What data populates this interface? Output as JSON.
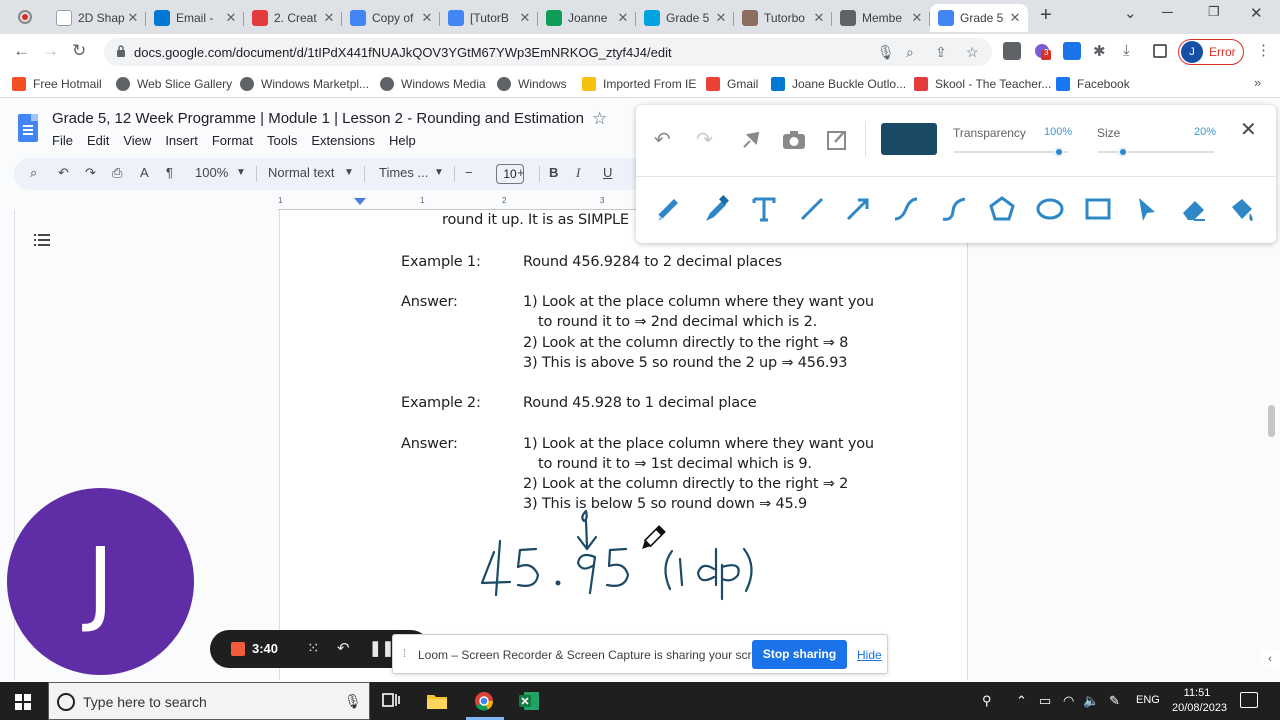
{
  "browser": {
    "tabs": [
      {
        "title": "2D Shap",
        "color": "#ffffff",
        "icon": "blank-page-icon"
      },
      {
        "title": "Email -",
        "color": "#0078d4",
        "icon": "outlook-icon"
      },
      {
        "title": "2. Creat",
        "color": "#e43c3c",
        "icon": "skool-icon"
      },
      {
        "title": "Copy of",
        "color": "#4285f4",
        "icon": "canva-icon"
      },
      {
        "title": "[TutorB",
        "color": "#4285f4",
        "icon": "docs-icon"
      },
      {
        "title": "Joanne",
        "color": "#0f9d58",
        "icon": "sheets-icon"
      },
      {
        "title": "Grade 5",
        "color": "#00a3e0",
        "icon": "vimeo-icon"
      },
      {
        "title": "Tutorbo",
        "color": "#8d6e63",
        "icon": "tutorbox-icon"
      },
      {
        "title": "Membe",
        "color": "#5f6368",
        "icon": "globe-icon"
      },
      {
        "title": "Grade 5",
        "color": "#4285f4",
        "icon": "docs-icon",
        "active": true
      }
    ],
    "url": "docs.google.com/document/d/1tIPdX441fNUAJkQOV3YGtM67YWp3EmNRKOG_ztyf4J4/edit",
    "profile_initial": "J",
    "profile_status": "Error",
    "extension_badge": "3",
    "bookmarks": [
      {
        "label": "Free Hotmail",
        "color": "#f25022"
      },
      {
        "label": "Web Slice Gallery",
        "color": "#5f6368"
      },
      {
        "label": "Windows Marketpl...",
        "color": "#5f6368"
      },
      {
        "label": "Windows Media",
        "color": "#5f6368"
      },
      {
        "label": "Windows",
        "color": "#5f6368"
      },
      {
        "label": "Imported From IE",
        "color": "#f4c20d"
      },
      {
        "label": "Gmail",
        "color": "#ea4335"
      },
      {
        "label": "Joane Buckle Outlo...",
        "color": "#0078d4"
      },
      {
        "label": "Skool - The Teacher...",
        "color": "#e43c3c"
      },
      {
        "label": "Facebook",
        "color": "#1877f2"
      }
    ]
  },
  "docs": {
    "title": "Grade 5, 12 Week Programme | Module 1 | Lesson 2 - Rounding and Estimation",
    "menus": [
      "File",
      "Edit",
      "View",
      "Insert",
      "Format",
      "Tools",
      "Extensions",
      "Help"
    ],
    "zoom": "100%",
    "style": "Normal text",
    "font": "Times ...",
    "font_size": "10",
    "ruler": [
      "1",
      "1",
      "2",
      "3"
    ],
    "lines": {
      "cutoff": "round it up. It is as SIMPLE",
      "ex1_label": "Example 1:",
      "ex1_text": "Round 456.9284 to 2 decimal places",
      "ans1_label": "Answer:",
      "ans1_l1": "1) Look at the place column where they want you",
      "ans1_l2": "to round it to ⇒ 2nd decimal which is 2.",
      "ans1_l3": "2) Look at the column directly to the right ⇒ 8",
      "ans1_l4": "3) This is above 5 so round the 2 up ⇒ 456.93",
      "ex2_label": "Example 2:",
      "ex2_text": "Round 45.928 to 1 decimal place",
      "ans2_label": "Answer:",
      "ans2_l1": "1) Look at the place column where they want you",
      "ans2_l2": "to round it to ⇒ 1st decimal which is 9.",
      "ans2_l3": "2) Look at the column directly to the right ⇒ 2",
      "ans2_l4": "3) This is below 5 so round down ⇒ 45.9"
    },
    "handwriting": "45.95 (1dp)"
  },
  "annotation_toolbar": {
    "color": "#1b4a66",
    "transparency_label": "Transparency",
    "transparency_value": "100%",
    "size_label": "Size",
    "size_value": "20%",
    "accent": "#2e88c8"
  },
  "presenter": {
    "initial": "J",
    "color": "#5f2ea6"
  },
  "recording": {
    "time": "3:40"
  },
  "share_bar": {
    "message": "Loom – Screen Recorder & Screen Capture is sharing your screen.",
    "stop_label": "Stop sharing",
    "hide_label": "Hide"
  },
  "taskbar": {
    "search_placeholder": "Type here to search",
    "language": "ENG",
    "time": "11:51",
    "date": "20/08/2023"
  }
}
